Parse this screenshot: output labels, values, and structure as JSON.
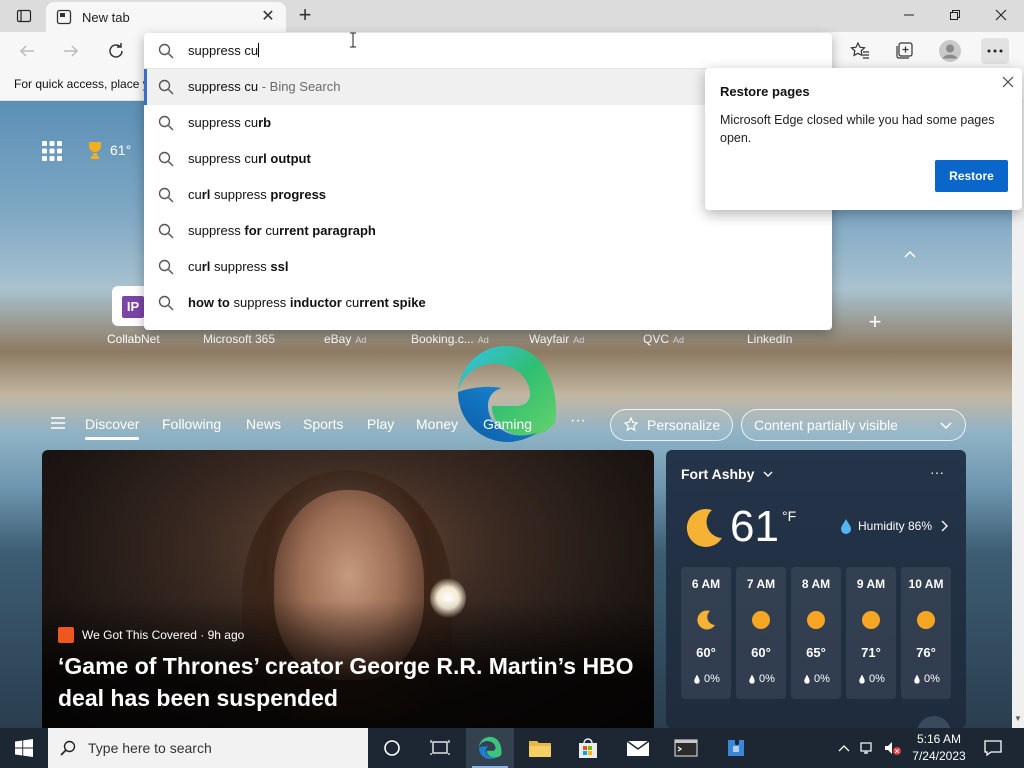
{
  "browser": {
    "tab_title": "New tab",
    "favorites_hint": "For quick access, place y"
  },
  "omnibox": {
    "query": "suppress cu",
    "suggestions": [
      {
        "text": "suppress cu",
        "suffix": " - Bing Search"
      },
      {
        "prefix": "suppress cu",
        "bold": "rb"
      },
      {
        "prefix": "suppress cu",
        "bold": "rl output"
      },
      {
        "prefix": "cu",
        "mid": "rl ",
        "mid2": "suppress ",
        "bold": "progress"
      },
      {
        "prefix": "suppress ",
        "bold": "for ",
        "mid": "cu",
        "bold2": "rrent paragraph"
      },
      {
        "prefix": "cu",
        "bold": "rl",
        "mid": " suppress ",
        "bold2": "ssl"
      },
      {
        "bold": "how to ",
        "prefix": "suppress ",
        "bold2": "inductor ",
        "mid": "cu",
        "bold3": "rrent spike"
      }
    ]
  },
  "restore": {
    "title": "Restore pages",
    "message": "Microsoft Edge closed while you had some pages open.",
    "button": "Restore"
  },
  "newtab": {
    "weather_temp": "61°",
    "quick_links": [
      {
        "label": "CollabNet",
        "ad": ""
      },
      {
        "label": "Microsoft 365",
        "ad": ""
      },
      {
        "label": "eBay",
        "ad": "Ad"
      },
      {
        "label": "Booking.c...",
        "ad": "Ad"
      },
      {
        "label": "Wayfair",
        "ad": "Ad"
      },
      {
        "label": "QVC",
        "ad": "Ad"
      },
      {
        "label": "LinkedIn",
        "ad": ""
      }
    ],
    "tile_letter": "IP",
    "categories": [
      "Discover",
      "Following",
      "News",
      "Sports",
      "Play",
      "Money",
      "Gaming"
    ],
    "more": "···",
    "personalize": "Personalize",
    "content_visibility": "Content partially visible"
  },
  "hero": {
    "source": "We Got This Covered · 9h ago",
    "headline": "‘Game of Thrones’ creator George R.R. Martin’s HBO deal has been suspended"
  },
  "weather": {
    "location": "Fort Ashby",
    "temp": "61",
    "unit": "°F",
    "humidity": "Humidity 86%",
    "menu": "···",
    "hourly": [
      {
        "time": "6 AM",
        "icon": "moon",
        "temp": "60°",
        "precip": "0%"
      },
      {
        "time": "7 AM",
        "icon": "sun",
        "temp": "60°",
        "precip": "0%"
      },
      {
        "time": "8 AM",
        "icon": "sun",
        "temp": "65°",
        "precip": "0%"
      },
      {
        "time": "9 AM",
        "icon": "sun",
        "temp": "71°",
        "precip": "0%"
      },
      {
        "time": "10 AM",
        "icon": "sun",
        "temp": "76°",
        "precip": "0%"
      }
    ]
  },
  "taskbar": {
    "search_placeholder": "Type here to search",
    "time": "5:16 AM",
    "date": "7/24/2023"
  }
}
